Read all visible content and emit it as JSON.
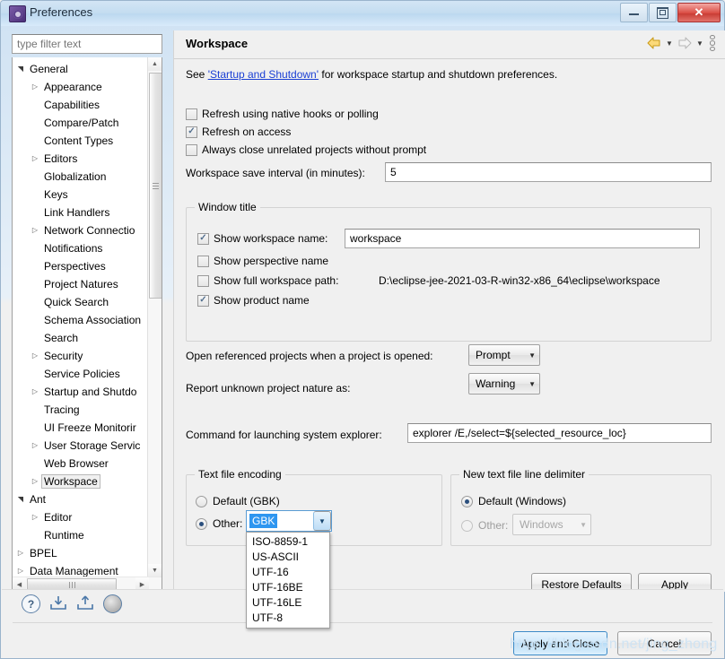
{
  "window": {
    "title": "Preferences",
    "icon": "preferences-gear-icon",
    "buttons": {
      "minimize": "minimize",
      "maximize": "restore",
      "close": "close"
    }
  },
  "sidebar": {
    "filter_placeholder": "type filter text",
    "filter_value": "",
    "items": [
      {
        "label": "General",
        "depth": 0,
        "arrow": "open",
        "selected": false
      },
      {
        "label": "Appearance",
        "depth": 1,
        "arrow": "closed",
        "selected": false
      },
      {
        "label": "Capabilities",
        "depth": 1,
        "arrow": "none",
        "selected": false
      },
      {
        "label": "Compare/Patch",
        "depth": 1,
        "arrow": "none",
        "selected": false
      },
      {
        "label": "Content Types",
        "depth": 1,
        "arrow": "none",
        "selected": false
      },
      {
        "label": "Editors",
        "depth": 1,
        "arrow": "closed",
        "selected": false
      },
      {
        "label": "Globalization",
        "depth": 1,
        "arrow": "none",
        "selected": false
      },
      {
        "label": "Keys",
        "depth": 1,
        "arrow": "none",
        "selected": false
      },
      {
        "label": "Link Handlers",
        "depth": 1,
        "arrow": "none",
        "selected": false
      },
      {
        "label": "Network Connectio",
        "depth": 1,
        "arrow": "closed",
        "selected": false
      },
      {
        "label": "Notifications",
        "depth": 1,
        "arrow": "none",
        "selected": false
      },
      {
        "label": "Perspectives",
        "depth": 1,
        "arrow": "none",
        "selected": false
      },
      {
        "label": "Project Natures",
        "depth": 1,
        "arrow": "none",
        "selected": false
      },
      {
        "label": "Quick Search",
        "depth": 1,
        "arrow": "none",
        "selected": false
      },
      {
        "label": "Schema Association",
        "depth": 1,
        "arrow": "none",
        "selected": false
      },
      {
        "label": "Search",
        "depth": 1,
        "arrow": "none",
        "selected": false
      },
      {
        "label": "Security",
        "depth": 1,
        "arrow": "closed",
        "selected": false
      },
      {
        "label": "Service Policies",
        "depth": 1,
        "arrow": "none",
        "selected": false
      },
      {
        "label": "Startup and Shutdo",
        "depth": 1,
        "arrow": "closed",
        "selected": false
      },
      {
        "label": "Tracing",
        "depth": 1,
        "arrow": "none",
        "selected": false
      },
      {
        "label": "UI Freeze Monitorir",
        "depth": 1,
        "arrow": "none",
        "selected": false
      },
      {
        "label": "User Storage Servic",
        "depth": 1,
        "arrow": "closed",
        "selected": false
      },
      {
        "label": "Web Browser",
        "depth": 1,
        "arrow": "none",
        "selected": false
      },
      {
        "label": "Workspace",
        "depth": 1,
        "arrow": "closed",
        "selected": true
      },
      {
        "label": "Ant",
        "depth": 0,
        "arrow": "open",
        "selected": false
      },
      {
        "label": "Editor",
        "depth": 1,
        "arrow": "closed",
        "selected": false
      },
      {
        "label": "Runtime",
        "depth": 1,
        "arrow": "none",
        "selected": false
      },
      {
        "label": "BPEL",
        "depth": 0,
        "arrow": "closed",
        "selected": false
      },
      {
        "label": "Data Management",
        "depth": 0,
        "arrow": "closed",
        "selected": false
      }
    ]
  },
  "page": {
    "title": "Workspace",
    "description_before": "See ",
    "description_link": "'Startup and Shutdown'",
    "description_after": " for workspace startup and shutdown preferences.",
    "nav": {
      "back": "back-arrow",
      "forward": "forward-arrow",
      "menu": "view-menu"
    }
  },
  "options": {
    "refresh_native_hooks": {
      "label": "Refresh using native hooks or polling",
      "checked": false
    },
    "refresh_on_access": {
      "label": "Refresh on access",
      "checked": true
    },
    "close_unrelated": {
      "label": "Always close unrelated projects without prompt",
      "checked": false
    },
    "save_interval_label": "Workspace save interval (in minutes):",
    "save_interval_value": "5"
  },
  "window_title_group": {
    "title": "Window title",
    "show_workspace_name": {
      "label": "Show workspace name:",
      "checked": true
    },
    "workspace_name_value": "workspace",
    "show_perspective_name": {
      "label": "Show perspective name",
      "checked": false
    },
    "show_full_path": {
      "label": "Show full workspace path:",
      "checked": false
    },
    "full_path_value": "D:\\eclipse-jee-2021-03-R-win32-x86_64\\eclipse\\workspace",
    "show_product_name": {
      "label": "Show product name",
      "checked": true
    }
  },
  "project_options": {
    "open_referenced_label": "Open referenced projects when a project is opened:",
    "open_referenced_value": "Prompt",
    "unknown_nature_label": "Report unknown project nature as:",
    "unknown_nature_value": "Warning"
  },
  "explorer": {
    "label": "Command for launching system explorer:",
    "value": "explorer /E,/select=${selected_resource_loc}"
  },
  "encoding_group": {
    "title": "Text file encoding",
    "default_label": "Default (GBK)",
    "default_selected": false,
    "other_label": "Other:",
    "other_selected": true,
    "selected_value": "GBK",
    "dropdown_open": true,
    "dropdown_items": [
      "ISO-8859-1",
      "US-ASCII",
      "UTF-16",
      "UTF-16BE",
      "UTF-16LE",
      "UTF-8"
    ]
  },
  "delimiter_group": {
    "title": "New text file line delimiter",
    "default_label": "Default (Windows)",
    "default_selected": true,
    "other_label": "Other:",
    "other_selected": false,
    "other_value": "Windows",
    "other_enabled": false
  },
  "buttons": {
    "restore_defaults": "Restore Defaults",
    "apply": "Apply",
    "apply_and_close": "Apply and Close",
    "cancel": "Cancel"
  },
  "footer_icons": [
    {
      "name": "help-icon",
      "glyph": "?"
    },
    {
      "name": "import-icon",
      "glyph": ""
    },
    {
      "name": "export-icon",
      "glyph": ""
    },
    {
      "name": "record-icon",
      "glyph": ""
    }
  ],
  "watermark": "https://blog.csdn.net/jing_zhong"
}
